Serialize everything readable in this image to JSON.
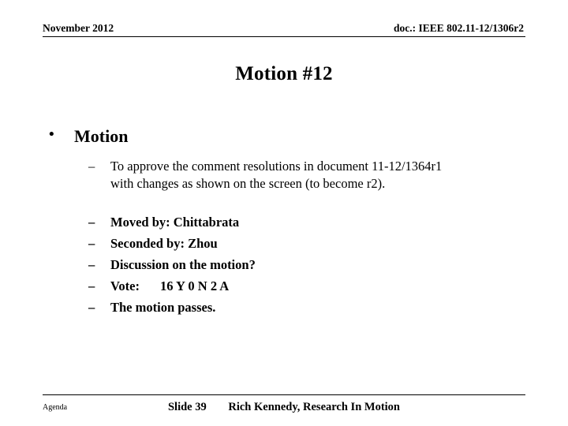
{
  "header": {
    "left": "November 2012",
    "right": "doc.: IEEE 802.11-12/1306r2"
  },
  "title": "Motion #12",
  "content": {
    "bullet_char": "•",
    "dash_char": "–",
    "level1": "Motion",
    "paragraph": {
      "line1": "To approve the comment resolutions in document 11-12/1364r1",
      "line2": "with changes as shown on the screen (to become r2)."
    },
    "items": [
      "Moved by: Chittabrata",
      "Seconded by: Zhou",
      "Discussion on the motion?",
      "The motion passes."
    ],
    "vote": {
      "label": "Vote:",
      "value": "16 Y  0 N  2 A"
    }
  },
  "footer": {
    "agenda": "Agenda",
    "slide_number": "Slide 39",
    "author": "Rich Kennedy, Research In Motion"
  }
}
